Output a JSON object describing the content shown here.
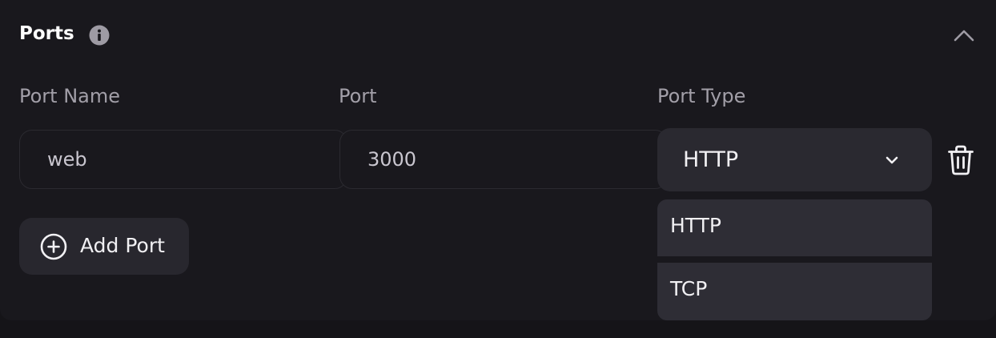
{
  "section": {
    "title": "Ports",
    "info_icon": "info-icon",
    "collapse_icon": "chevron-up-icon"
  },
  "columns": {
    "port_name": "Port Name",
    "port": "Port",
    "port_type": "Port Type"
  },
  "row": {
    "port_name_value": "web",
    "port_value": "3000",
    "port_type_value": "HTTP",
    "delete_icon": "trash-icon"
  },
  "add_port": {
    "label": "Add Port",
    "icon": "plus-circle-icon"
  },
  "dropdown": {
    "options": [
      "HTTP",
      "TCP"
    ]
  },
  "colors": {
    "background": "#19181d",
    "surface": "#2a2930",
    "text_primary": "#f1f0f3",
    "text_muted": "#a29fa8"
  }
}
